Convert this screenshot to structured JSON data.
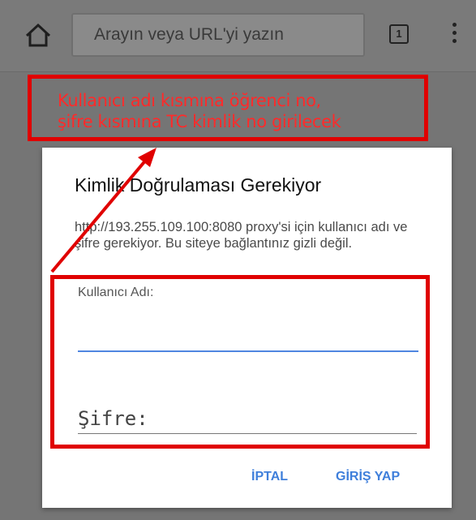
{
  "browser": {
    "url_placeholder": "Arayın veya URL'yi yazın",
    "tab_count": "1",
    "icons": [
      "home-icon",
      "tab-switcher-icon",
      "overflow-menu-icon"
    ]
  },
  "annotation": {
    "line1": "Kullanıcı adı kısmına öğrenci no,",
    "line2": "şifre kısmına TC kimlik no girilecek",
    "color": "#ff2a2a"
  },
  "dialog": {
    "title": "Kimlik Doğrulaması Gerekiyor",
    "message": "http://193.255.109.100:8080 proxy'si için kullanıcı adı ve şifre gerekiyor. Bu siteye bağlantınız gizli değil.",
    "username_label": "Kullanıcı Adı:",
    "username_value": "",
    "password_placeholder": "Şifre:",
    "password_value": "",
    "cancel_label": "İPTAL",
    "login_label": "GİRİŞ YAP",
    "accent_color": "#3f7fdb"
  }
}
